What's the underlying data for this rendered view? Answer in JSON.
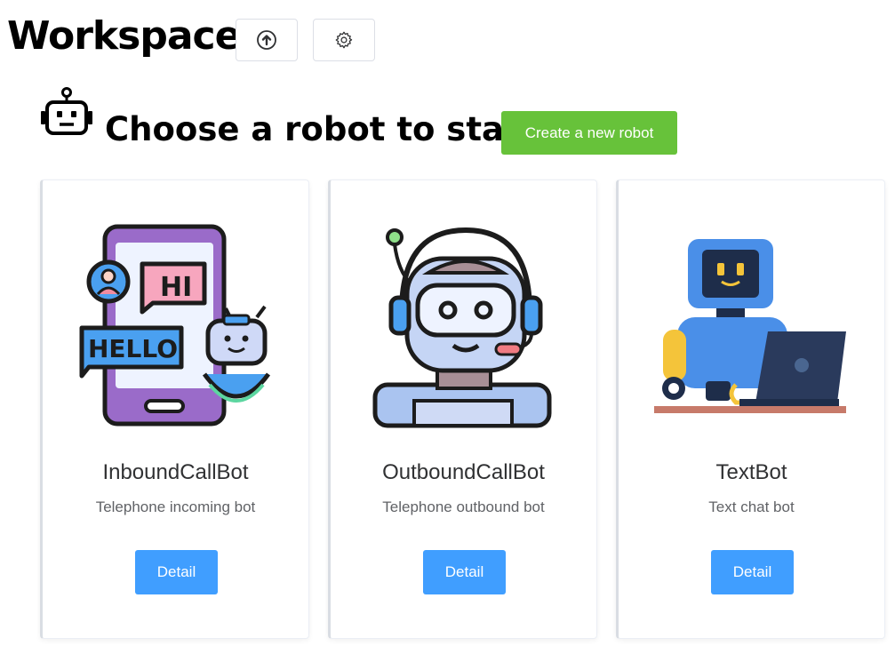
{
  "header": {
    "title": "Workspace",
    "upload_icon": "upload-circle-icon",
    "settings_icon": "gear-icon"
  },
  "section": {
    "robot_icon": "robot-head-icon",
    "title": "Choose a robot to start",
    "create_label": "Create a new robot"
  },
  "robots": [
    {
      "name": "InboundCallBot",
      "description": "Telephone incoming bot",
      "detail_label": "Detail",
      "illustration": "phone-chat-bot-illustration"
    },
    {
      "name": "OutboundCallBot",
      "description": "Telephone outbound bot",
      "detail_label": "Detail",
      "illustration": "headset-robot-illustration"
    },
    {
      "name": "TextBot",
      "description": "Text chat bot",
      "detail_label": "Detail",
      "illustration": "laptop-robot-illustration"
    }
  ],
  "colors": {
    "primary": "#409eff",
    "success": "#67c23a",
    "text": "#303133",
    "muted": "#606266"
  }
}
